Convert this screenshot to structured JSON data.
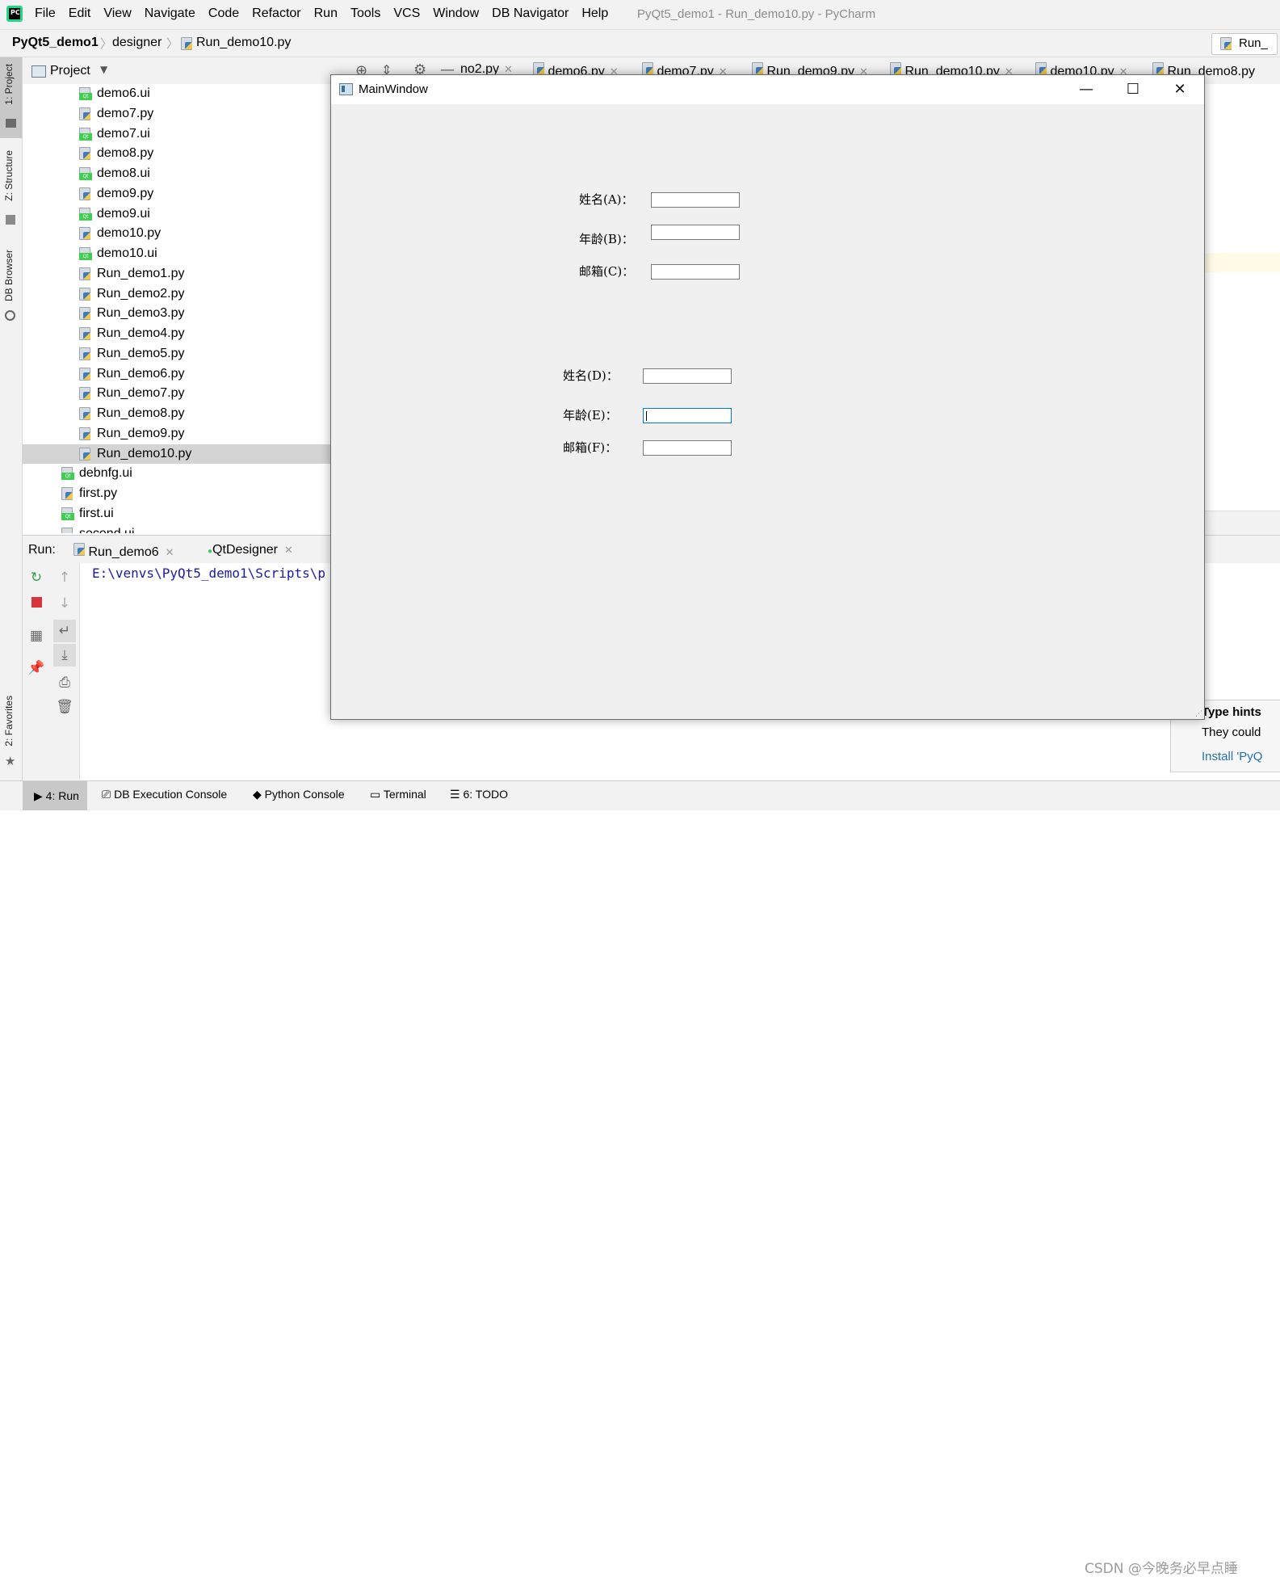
{
  "menubar": {
    "items": [
      "File",
      "Edit",
      "View",
      "Navigate",
      "Code",
      "Refactor",
      "Run",
      "Tools",
      "VCS",
      "Window",
      "DB Navigator",
      "Help"
    ],
    "window_title": "PyQt5_demo1 - Run_demo10.py - PyCharm"
  },
  "navbar": {
    "project": "PyQt5_demo1",
    "folder": "designer",
    "file": "Run_demo10.py",
    "run_config": "Run_"
  },
  "left_strip": {
    "project_tab": "1: Project",
    "structure_tab": "Z: Structure",
    "db_browser_tab": "DB Browser",
    "favorites_tab": "2: Favorites"
  },
  "project_panel": {
    "title": "Project",
    "items": [
      {
        "name": "demo6.ui",
        "type": "ui"
      },
      {
        "name": "demo7.py",
        "type": "py"
      },
      {
        "name": "demo7.ui",
        "type": "ui"
      },
      {
        "name": "demo8.py",
        "type": "py"
      },
      {
        "name": "demo8.ui",
        "type": "ui"
      },
      {
        "name": "demo9.py",
        "type": "py"
      },
      {
        "name": "demo9.ui",
        "type": "ui"
      },
      {
        "name": "demo10.py",
        "type": "py"
      },
      {
        "name": "demo10.ui",
        "type": "ui"
      },
      {
        "name": "Run_demo1.py",
        "type": "py"
      },
      {
        "name": "Run_demo2.py",
        "type": "py"
      },
      {
        "name": "Run_demo3.py",
        "type": "py"
      },
      {
        "name": "Run_demo4.py",
        "type": "py"
      },
      {
        "name": "Run_demo5.py",
        "type": "py"
      },
      {
        "name": "Run_demo6.py",
        "type": "py"
      },
      {
        "name": "Run_demo7.py",
        "type": "py"
      },
      {
        "name": "Run_demo8.py",
        "type": "py"
      },
      {
        "name": "Run_demo9.py",
        "type": "py"
      },
      {
        "name": "Run_demo10.py",
        "type": "py",
        "selected": true
      },
      {
        "name": "debnfg.ui",
        "type": "ui",
        "level": 1
      },
      {
        "name": "first.py",
        "type": "py",
        "level": 1
      },
      {
        "name": "first.ui",
        "type": "ui",
        "level": 1
      },
      {
        "name": "second.ui",
        "type": "ui",
        "level": 1
      }
    ]
  },
  "editor_tabs": [
    "no2.py",
    "demo6.py",
    "demo7.py",
    "Run_demo9.py",
    "Run_demo10.py",
    "demo10.py",
    "Run_demo8.py"
  ],
  "run_panel": {
    "label": "Run:",
    "tabs": [
      "Run_demo6",
      "QtDesigner"
    ],
    "console_text": "E:\\venvs\\PyQt5_demo1\\Scripts\\p"
  },
  "hint": {
    "title": "Type hints",
    "body": "They could",
    "link": "Install 'PyQ"
  },
  "statusbar": {
    "items": [
      "4: Run",
      "DB Execution Console",
      "Python Console",
      "Terminal",
      "6: TODO"
    ]
  },
  "watermark": "CSDN @今晚务必早点睡",
  "main_window": {
    "title": "MainWindow",
    "minimize": "—",
    "maximize": "☐",
    "close": "✕",
    "form1": {
      "name_label": "姓名(A)：",
      "age_label": "年龄(B)：",
      "email_label": "邮箱(C)：",
      "name_value": "",
      "age_value": "",
      "email_value": ""
    },
    "form2": {
      "name_label": "姓名(D)：",
      "age_label": "年龄(E)：",
      "email_label": "邮箱(F)：",
      "name_value": "",
      "age_value": "",
      "email_value": ""
    }
  },
  "colors": {
    "accent": "#0078d7",
    "console_text": "#1a1aa6",
    "link": "#2470b3",
    "selection": "#d4d4d4"
  }
}
